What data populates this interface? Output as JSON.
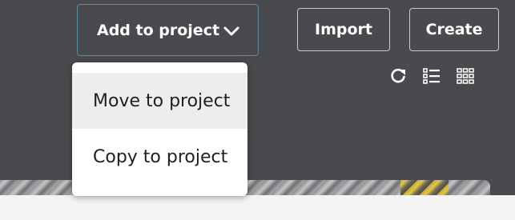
{
  "toolbar": {
    "add_to_project_label": "Add to project",
    "import_label": "Import",
    "create_label": "Create"
  },
  "dropdown": {
    "items": [
      {
        "label": "Move to project",
        "highlighted": true
      },
      {
        "label": "Copy to project",
        "highlighted": false
      }
    ]
  },
  "view_controls": {
    "icons": [
      "refresh-icon",
      "list-view-icon",
      "grid-view-icon"
    ]
  },
  "colors": {
    "background": "#494a4e",
    "button_border": "#c9cacc",
    "active_button_border": "#5d8aa3",
    "menu_highlight": "#ededec"
  }
}
